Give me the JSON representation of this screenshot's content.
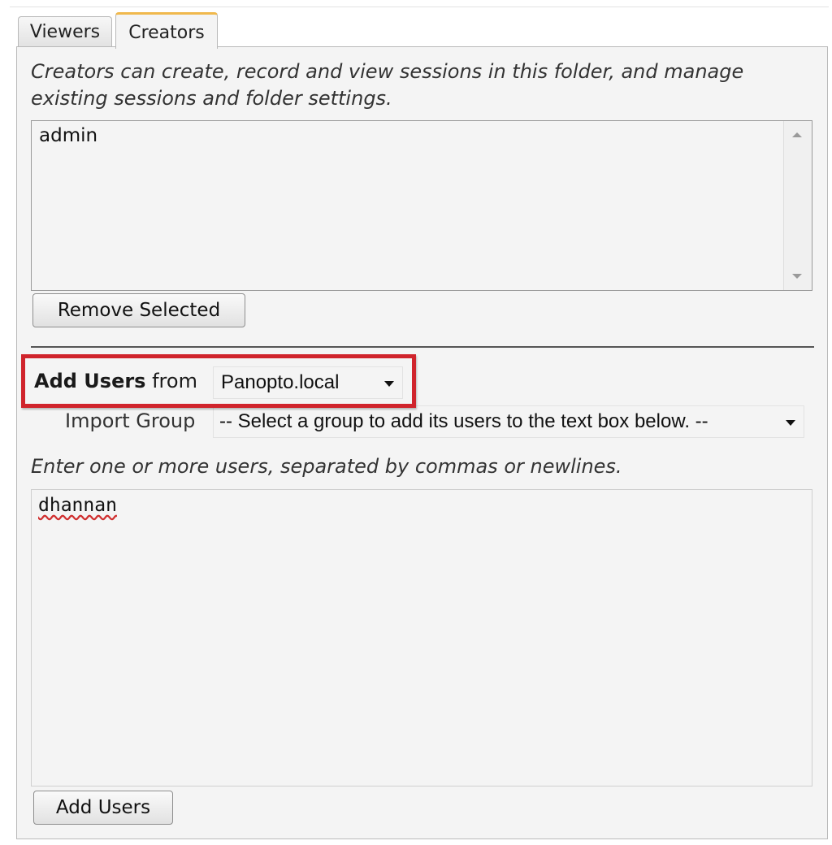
{
  "tabs": [
    {
      "label": "Viewers",
      "active": false
    },
    {
      "label": "Creators",
      "active": true
    }
  ],
  "creators": {
    "description": "Creators can create, record and view sessions in this folder, and manage existing sessions and folder settings.",
    "list_items": [
      "admin"
    ],
    "remove_button": "Remove Selected"
  },
  "add_users": {
    "label_bold": "Add Users",
    "label_from": "from",
    "provider_value": "Panopto.local",
    "import_group_label": "Import Group",
    "import_group_value": "-- Select a group to add its users to the text box below. --",
    "instructions": "Enter one or more users, separated by commas or newlines.",
    "users_value": "dhannan",
    "add_button": "Add Users"
  },
  "colors": {
    "highlight_border": "#d0242c",
    "active_tab_accent": "#f0b84c"
  },
  "icons": {
    "dropdown": "chevron-down-icon",
    "scroll_up": "scroll-up-arrow-icon",
    "scroll_down": "scroll-down-arrow-icon"
  }
}
